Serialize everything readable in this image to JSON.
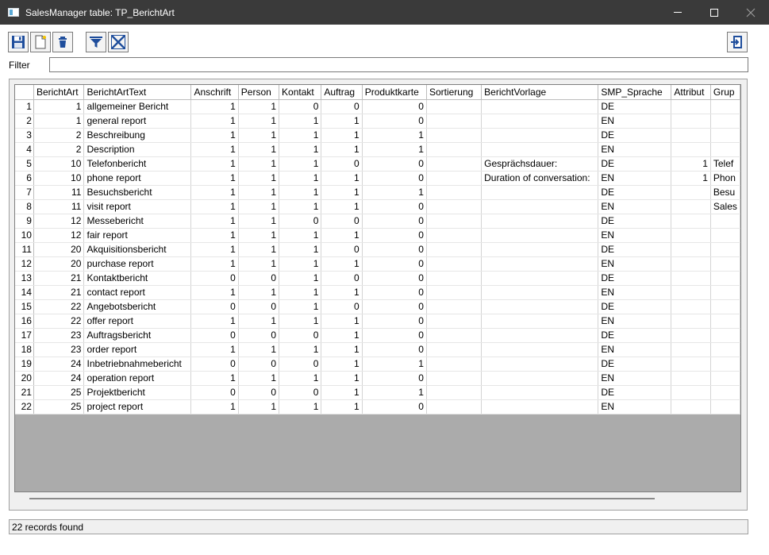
{
  "window": {
    "title": "SalesManager table: TP_BerichtArt"
  },
  "filter": {
    "label": "Filter",
    "value": "",
    "placeholder": ""
  },
  "table": {
    "columns": [
      {
        "key": "berichtart",
        "label": "BerichtArt",
        "align": "num",
        "width": 64
      },
      {
        "key": "berichtarttext",
        "label": "BerichtArtText",
        "align": "txt",
        "width": 136
      },
      {
        "key": "anschrift",
        "label": "Anschrift",
        "align": "num",
        "width": 60
      },
      {
        "key": "person",
        "label": "Person",
        "align": "num",
        "width": 52
      },
      {
        "key": "kontakt",
        "label": "Kontakt",
        "align": "num",
        "width": 54
      },
      {
        "key": "auftrag",
        "label": "Auftrag",
        "align": "num",
        "width": 52
      },
      {
        "key": "produktkarte",
        "label": "Produktkarte",
        "align": "num",
        "width": 82
      },
      {
        "key": "sortierung",
        "label": "Sortierung",
        "align": "num",
        "width": 70
      },
      {
        "key": "berichtvorlage",
        "label": "BerichtVorlage",
        "align": "txt",
        "width": 148
      },
      {
        "key": "smp_sprache",
        "label": "SMP_Sprache",
        "align": "txt",
        "width": 93
      },
      {
        "key": "attribut",
        "label": "Attribut",
        "align": "num",
        "width": 50
      },
      {
        "key": "grup",
        "label": "Grup",
        "align": "txt",
        "width": 34
      }
    ],
    "rows": [
      {
        "n": "1",
        "berichtart": "1",
        "berichtarttext": "allgemeiner Bericht",
        "anschrift": "1",
        "person": "1",
        "kontakt": "0",
        "auftrag": "0",
        "produktkarte": "0",
        "sortierung": "",
        "berichtvorlage": "",
        "smp_sprache": "DE",
        "attribut": "",
        "grup": ""
      },
      {
        "n": "2",
        "berichtart": "1",
        "berichtarttext": "general report",
        "anschrift": "1",
        "person": "1",
        "kontakt": "1",
        "auftrag": "1",
        "produktkarte": "0",
        "sortierung": "",
        "berichtvorlage": "",
        "smp_sprache": "EN",
        "attribut": "",
        "grup": ""
      },
      {
        "n": "3",
        "berichtart": "2",
        "berichtarttext": "Beschreibung",
        "anschrift": "1",
        "person": "1",
        "kontakt": "1",
        "auftrag": "1",
        "produktkarte": "1",
        "sortierung": "",
        "berichtvorlage": "",
        "smp_sprache": "DE",
        "attribut": "",
        "grup": ""
      },
      {
        "n": "4",
        "berichtart": "2",
        "berichtarttext": "Description",
        "anschrift": "1",
        "person": "1",
        "kontakt": "1",
        "auftrag": "1",
        "produktkarte": "1",
        "sortierung": "",
        "berichtvorlage": "",
        "smp_sprache": "EN",
        "attribut": "",
        "grup": ""
      },
      {
        "n": "5",
        "berichtart": "10",
        "berichtarttext": "Telefonbericht",
        "anschrift": "1",
        "person": "1",
        "kontakt": "1",
        "auftrag": "0",
        "produktkarte": "0",
        "sortierung": "",
        "berichtvorlage": "Gesprächsdauer:",
        "smp_sprache": "DE",
        "attribut": "1",
        "grup": "Telef"
      },
      {
        "n": "6",
        "berichtart": "10",
        "berichtarttext": "phone report",
        "anschrift": "1",
        "person": "1",
        "kontakt": "1",
        "auftrag": "1",
        "produktkarte": "0",
        "sortierung": "",
        "berichtvorlage": "Duration of conversation:",
        "smp_sprache": "EN",
        "attribut": "1",
        "grup": "Phon"
      },
      {
        "n": "7",
        "berichtart": "11",
        "berichtarttext": "Besuchsbericht",
        "anschrift": "1",
        "person": "1",
        "kontakt": "1",
        "auftrag": "1",
        "produktkarte": "1",
        "sortierung": "",
        "berichtvorlage": "",
        "smp_sprache": "DE",
        "attribut": "",
        "grup": "Besu"
      },
      {
        "n": "8",
        "berichtart": "11",
        "berichtarttext": "visit report",
        "anschrift": "1",
        "person": "1",
        "kontakt": "1",
        "auftrag": "1",
        "produktkarte": "0",
        "sortierung": "",
        "berichtvorlage": "",
        "smp_sprache": "EN",
        "attribut": "",
        "grup": "Sales"
      },
      {
        "n": "9",
        "berichtart": "12",
        "berichtarttext": "Messebericht",
        "anschrift": "1",
        "person": "1",
        "kontakt": "0",
        "auftrag": "0",
        "produktkarte": "0",
        "sortierung": "",
        "berichtvorlage": "",
        "smp_sprache": "DE",
        "attribut": "",
        "grup": ""
      },
      {
        "n": "10",
        "berichtart": "12",
        "berichtarttext": "fair report",
        "anschrift": "1",
        "person": "1",
        "kontakt": "1",
        "auftrag": "1",
        "produktkarte": "0",
        "sortierung": "",
        "berichtvorlage": "",
        "smp_sprache": "EN",
        "attribut": "",
        "grup": ""
      },
      {
        "n": "11",
        "berichtart": "20",
        "berichtarttext": "Akquisitionsbericht",
        "anschrift": "1",
        "person": "1",
        "kontakt": "1",
        "auftrag": "0",
        "produktkarte": "0",
        "sortierung": "",
        "berichtvorlage": "",
        "smp_sprache": "DE",
        "attribut": "",
        "grup": ""
      },
      {
        "n": "12",
        "berichtart": "20",
        "berichtarttext": "purchase report",
        "anschrift": "1",
        "person": "1",
        "kontakt": "1",
        "auftrag": "1",
        "produktkarte": "0",
        "sortierung": "",
        "berichtvorlage": "",
        "smp_sprache": "EN",
        "attribut": "",
        "grup": ""
      },
      {
        "n": "13",
        "berichtart": "21",
        "berichtarttext": "Kontaktbericht",
        "anschrift": "0",
        "person": "0",
        "kontakt": "1",
        "auftrag": "0",
        "produktkarte": "0",
        "sortierung": "",
        "berichtvorlage": "",
        "smp_sprache": "DE",
        "attribut": "",
        "grup": ""
      },
      {
        "n": "14",
        "berichtart": "21",
        "berichtarttext": "contact report",
        "anschrift": "1",
        "person": "1",
        "kontakt": "1",
        "auftrag": "1",
        "produktkarte": "0",
        "sortierung": "",
        "berichtvorlage": "",
        "smp_sprache": "EN",
        "attribut": "",
        "grup": ""
      },
      {
        "n": "15",
        "berichtart": "22",
        "berichtarttext": "Angebotsbericht",
        "anschrift": "0",
        "person": "0",
        "kontakt": "1",
        "auftrag": "0",
        "produktkarte": "0",
        "sortierung": "",
        "berichtvorlage": "",
        "smp_sprache": "DE",
        "attribut": "",
        "grup": ""
      },
      {
        "n": "16",
        "berichtart": "22",
        "berichtarttext": "offer report",
        "anschrift": "1",
        "person": "1",
        "kontakt": "1",
        "auftrag": "1",
        "produktkarte": "0",
        "sortierung": "",
        "berichtvorlage": "",
        "smp_sprache": "EN",
        "attribut": "",
        "grup": ""
      },
      {
        "n": "17",
        "berichtart": "23",
        "berichtarttext": "Auftragsbericht",
        "anschrift": "0",
        "person": "0",
        "kontakt": "0",
        "auftrag": "1",
        "produktkarte": "0",
        "sortierung": "",
        "berichtvorlage": "",
        "smp_sprache": "DE",
        "attribut": "",
        "grup": ""
      },
      {
        "n": "18",
        "berichtart": "23",
        "berichtarttext": "order report",
        "anschrift": "1",
        "person": "1",
        "kontakt": "1",
        "auftrag": "1",
        "produktkarte": "0",
        "sortierung": "",
        "berichtvorlage": "",
        "smp_sprache": "EN",
        "attribut": "",
        "grup": ""
      },
      {
        "n": "19",
        "berichtart": "24",
        "berichtarttext": "Inbetriebnahmebericht",
        "anschrift": "0",
        "person": "0",
        "kontakt": "0",
        "auftrag": "1",
        "produktkarte": "1",
        "sortierung": "",
        "berichtvorlage": "",
        "smp_sprache": "DE",
        "attribut": "",
        "grup": ""
      },
      {
        "n": "20",
        "berichtart": "24",
        "berichtarttext": "operation report",
        "anschrift": "1",
        "person": "1",
        "kontakt": "1",
        "auftrag": "1",
        "produktkarte": "0",
        "sortierung": "",
        "berichtvorlage": "",
        "smp_sprache": "EN",
        "attribut": "",
        "grup": ""
      },
      {
        "n": "21",
        "berichtart": "25",
        "berichtarttext": "Projektbericht",
        "anschrift": "0",
        "person": "0",
        "kontakt": "0",
        "auftrag": "1",
        "produktkarte": "1",
        "sortierung": "",
        "berichtvorlage": "",
        "smp_sprache": "DE",
        "attribut": "",
        "grup": ""
      },
      {
        "n": "22",
        "berichtart": "25",
        "berichtarttext": "project report",
        "anschrift": "1",
        "person": "1",
        "kontakt": "1",
        "auftrag": "1",
        "produktkarte": "0",
        "sortierung": "",
        "berichtvorlage": "",
        "smp_sprache": "EN",
        "attribut": "",
        "grup": ""
      }
    ]
  },
  "status": {
    "text": "22 records found"
  },
  "toolbar": {
    "icons": [
      "save-icon",
      "new-record-icon",
      "delete-icon",
      "filter-icon",
      "clear-filter-icon",
      "exit-icon"
    ]
  },
  "colors": {
    "titlebar": "#3a3a3a",
    "icon_blue": "#1f4e9c",
    "grid_empty_area": "#ababab"
  }
}
